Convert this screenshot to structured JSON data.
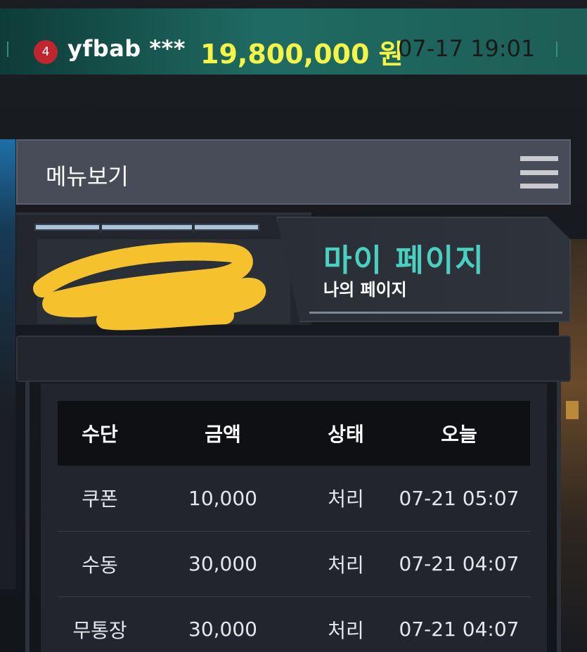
{
  "ticker": {
    "rank": "4",
    "user": "yfbab ***",
    "amount": "19,800,000 원",
    "time": "07-17 19:01"
  },
  "menu": {
    "label": "메뉴보기",
    "icon": "hamburger-icon"
  },
  "page": {
    "title": "마이 페이지",
    "subtitle": "나의 페이지"
  },
  "table": {
    "headers": [
      "수단",
      "금액",
      "상태",
      "오늘"
    ],
    "rows": [
      [
        "쿠폰",
        "10,000",
        "처리",
        "07-21 05:07"
      ],
      [
        "수동",
        "30,000",
        "처리",
        "07-21 04:07"
      ],
      [
        "무통장",
        "30,000",
        "처리",
        "07-21 04:07"
      ]
    ]
  },
  "colors": {
    "accent": "#4ad0c0",
    "amount": "#f5f548",
    "badge": "#c0262e",
    "ticker_bg": "#1f6b63"
  }
}
